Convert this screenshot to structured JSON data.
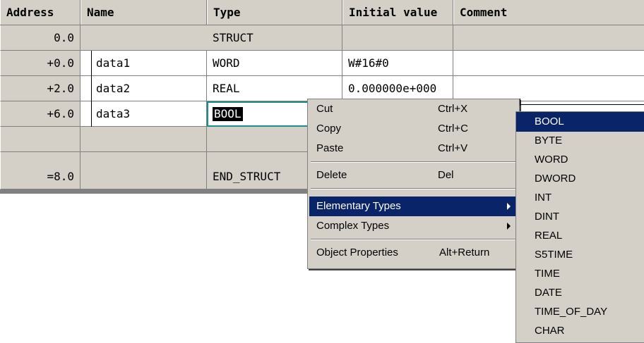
{
  "table": {
    "headers": [
      "Address",
      "Name",
      "Type",
      "Initial value",
      "Comment"
    ],
    "rows": [
      {
        "address": "0.0",
        "name": "",
        "type": "STRUCT",
        "initial": "",
        "comment": ""
      },
      {
        "address": "+0.0",
        "name": "data1",
        "type": "WORD",
        "initial": "W#16#0",
        "comment": ""
      },
      {
        "address": "+2.0",
        "name": "data2",
        "type": "REAL",
        "initial": "0.000000e+000",
        "comment": ""
      },
      {
        "address": "+6.0",
        "name": "data3",
        "type": "BOOL",
        "initial": "",
        "comment": ""
      },
      {
        "address": "",
        "name": "",
        "type": "",
        "initial": "",
        "comment": ""
      },
      {
        "address": "",
        "name": "",
        "type": "",
        "initial": "",
        "comment": ""
      },
      {
        "address": "=8.0",
        "name": "",
        "type": "END_STRUCT",
        "initial": "",
        "comment": ""
      }
    ]
  },
  "context_menu": {
    "items": [
      {
        "label": "Cut",
        "shortcut": "Ctrl+X"
      },
      {
        "label": "Copy",
        "shortcut": "Ctrl+C"
      },
      {
        "label": "Paste",
        "shortcut": "Ctrl+V"
      },
      {
        "label": "Delete",
        "shortcut": "Del"
      },
      {
        "label": "Elementary Types",
        "shortcut": ""
      },
      {
        "label": "Complex Types",
        "shortcut": ""
      },
      {
        "label": "Object Properties",
        "shortcut": "Alt+Return"
      }
    ]
  },
  "submenu": {
    "items": [
      "BOOL",
      "BYTE",
      "WORD",
      "DWORD",
      "INT",
      "DINT",
      "REAL",
      "S5TIME",
      "TIME",
      "DATE",
      "TIME_OF_DAY",
      "CHAR"
    ]
  },
  "colors": {
    "highlight": "#0a246a",
    "menu_bg": "#d4d0c8",
    "edit_border": "#1a8f8f"
  }
}
